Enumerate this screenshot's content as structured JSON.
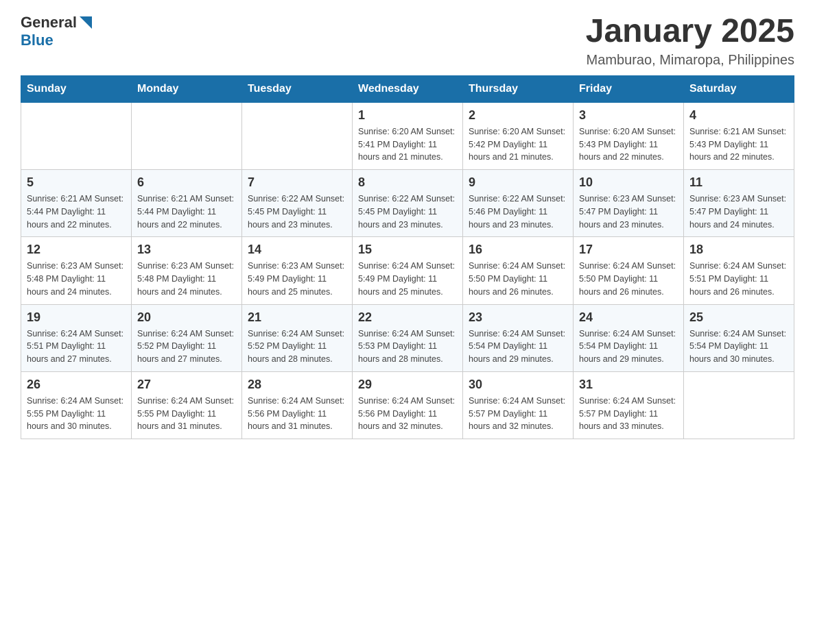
{
  "header": {
    "logo_general": "General",
    "logo_blue": "Blue",
    "month_title": "January 2025",
    "subtitle": "Mamburao, Mimaropa, Philippines"
  },
  "days_of_week": [
    "Sunday",
    "Monday",
    "Tuesday",
    "Wednesday",
    "Thursday",
    "Friday",
    "Saturday"
  ],
  "weeks": [
    [
      {
        "day": "",
        "info": ""
      },
      {
        "day": "",
        "info": ""
      },
      {
        "day": "",
        "info": ""
      },
      {
        "day": "1",
        "info": "Sunrise: 6:20 AM\nSunset: 5:41 PM\nDaylight: 11 hours and 21 minutes."
      },
      {
        "day": "2",
        "info": "Sunrise: 6:20 AM\nSunset: 5:42 PM\nDaylight: 11 hours and 21 minutes."
      },
      {
        "day": "3",
        "info": "Sunrise: 6:20 AM\nSunset: 5:43 PM\nDaylight: 11 hours and 22 minutes."
      },
      {
        "day": "4",
        "info": "Sunrise: 6:21 AM\nSunset: 5:43 PM\nDaylight: 11 hours and 22 minutes."
      }
    ],
    [
      {
        "day": "5",
        "info": "Sunrise: 6:21 AM\nSunset: 5:44 PM\nDaylight: 11 hours and 22 minutes."
      },
      {
        "day": "6",
        "info": "Sunrise: 6:21 AM\nSunset: 5:44 PM\nDaylight: 11 hours and 22 minutes."
      },
      {
        "day": "7",
        "info": "Sunrise: 6:22 AM\nSunset: 5:45 PM\nDaylight: 11 hours and 23 minutes."
      },
      {
        "day": "8",
        "info": "Sunrise: 6:22 AM\nSunset: 5:45 PM\nDaylight: 11 hours and 23 minutes."
      },
      {
        "day": "9",
        "info": "Sunrise: 6:22 AM\nSunset: 5:46 PM\nDaylight: 11 hours and 23 minutes."
      },
      {
        "day": "10",
        "info": "Sunrise: 6:23 AM\nSunset: 5:47 PM\nDaylight: 11 hours and 23 minutes."
      },
      {
        "day": "11",
        "info": "Sunrise: 6:23 AM\nSunset: 5:47 PM\nDaylight: 11 hours and 24 minutes."
      }
    ],
    [
      {
        "day": "12",
        "info": "Sunrise: 6:23 AM\nSunset: 5:48 PM\nDaylight: 11 hours and 24 minutes."
      },
      {
        "day": "13",
        "info": "Sunrise: 6:23 AM\nSunset: 5:48 PM\nDaylight: 11 hours and 24 minutes."
      },
      {
        "day": "14",
        "info": "Sunrise: 6:23 AM\nSunset: 5:49 PM\nDaylight: 11 hours and 25 minutes."
      },
      {
        "day": "15",
        "info": "Sunrise: 6:24 AM\nSunset: 5:49 PM\nDaylight: 11 hours and 25 minutes."
      },
      {
        "day": "16",
        "info": "Sunrise: 6:24 AM\nSunset: 5:50 PM\nDaylight: 11 hours and 26 minutes."
      },
      {
        "day": "17",
        "info": "Sunrise: 6:24 AM\nSunset: 5:50 PM\nDaylight: 11 hours and 26 minutes."
      },
      {
        "day": "18",
        "info": "Sunrise: 6:24 AM\nSunset: 5:51 PM\nDaylight: 11 hours and 26 minutes."
      }
    ],
    [
      {
        "day": "19",
        "info": "Sunrise: 6:24 AM\nSunset: 5:51 PM\nDaylight: 11 hours and 27 minutes."
      },
      {
        "day": "20",
        "info": "Sunrise: 6:24 AM\nSunset: 5:52 PM\nDaylight: 11 hours and 27 minutes."
      },
      {
        "day": "21",
        "info": "Sunrise: 6:24 AM\nSunset: 5:52 PM\nDaylight: 11 hours and 28 minutes."
      },
      {
        "day": "22",
        "info": "Sunrise: 6:24 AM\nSunset: 5:53 PM\nDaylight: 11 hours and 28 minutes."
      },
      {
        "day": "23",
        "info": "Sunrise: 6:24 AM\nSunset: 5:54 PM\nDaylight: 11 hours and 29 minutes."
      },
      {
        "day": "24",
        "info": "Sunrise: 6:24 AM\nSunset: 5:54 PM\nDaylight: 11 hours and 29 minutes."
      },
      {
        "day": "25",
        "info": "Sunrise: 6:24 AM\nSunset: 5:54 PM\nDaylight: 11 hours and 30 minutes."
      }
    ],
    [
      {
        "day": "26",
        "info": "Sunrise: 6:24 AM\nSunset: 5:55 PM\nDaylight: 11 hours and 30 minutes."
      },
      {
        "day": "27",
        "info": "Sunrise: 6:24 AM\nSunset: 5:55 PM\nDaylight: 11 hours and 31 minutes."
      },
      {
        "day": "28",
        "info": "Sunrise: 6:24 AM\nSunset: 5:56 PM\nDaylight: 11 hours and 31 minutes."
      },
      {
        "day": "29",
        "info": "Sunrise: 6:24 AM\nSunset: 5:56 PM\nDaylight: 11 hours and 32 minutes."
      },
      {
        "day": "30",
        "info": "Sunrise: 6:24 AM\nSunset: 5:57 PM\nDaylight: 11 hours and 32 minutes."
      },
      {
        "day": "31",
        "info": "Sunrise: 6:24 AM\nSunset: 5:57 PM\nDaylight: 11 hours and 33 minutes."
      },
      {
        "day": "",
        "info": ""
      }
    ]
  ]
}
